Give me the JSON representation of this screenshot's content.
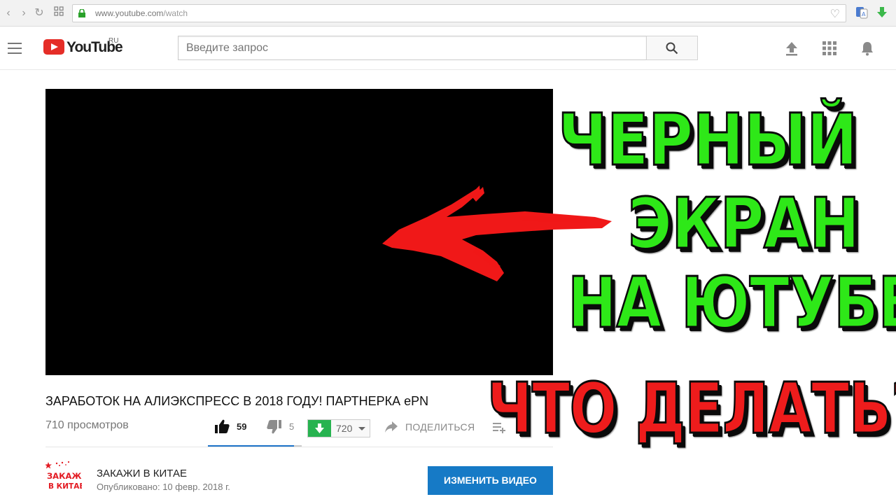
{
  "browser": {
    "url_host": "www.youtube.com",
    "url_path": "/watch",
    "back_icon": "back-arrow-icon",
    "forward_icon": "forward-arrow-icon",
    "reload_icon": "reload-icon",
    "apps_icon": "apps-grid-icon"
  },
  "header": {
    "logo_text": "YouTube",
    "logo_region": "RU",
    "search_placeholder": "Введите запрос",
    "icons": [
      "menu-icon",
      "search-icon",
      "upload-icon",
      "apps-icon",
      "bell-icon"
    ]
  },
  "video": {
    "title": "ЗАРАБОТОК НА АЛИЭКСПРЕСС В 2018 ГОДУ! ПАРТНЕРКА ePN",
    "views": "710 просмотров",
    "likes": "59",
    "dislikes": "5",
    "like_ratio": 0.92,
    "download_quality": "720",
    "share_label": "ПОДЕЛИТЬСЯ"
  },
  "channel": {
    "logo_text_top": "ЗАКАЖИ",
    "logo_text_bottom": "В КИТАЕ",
    "name": "ЗАКАЖИ В КИТАЕ",
    "published": "Опубликовано: 10 февр. 2018 г.",
    "edit_button": "ИЗМЕНИТЬ ВИДЕО"
  },
  "overlay": {
    "line1": "ЧЕРНЫЙ",
    "line2": "ЭКРАН",
    "line3": "НА ЮТУБЕ",
    "line4": "ЧТО ДЕЛАТЬ?",
    "green_color": "#2ee818",
    "red_color": "#ee1c1c"
  },
  "colors": {
    "youtube_red": "#e52d27",
    "accent_blue": "#167ac6",
    "download_green": "#27b350"
  }
}
